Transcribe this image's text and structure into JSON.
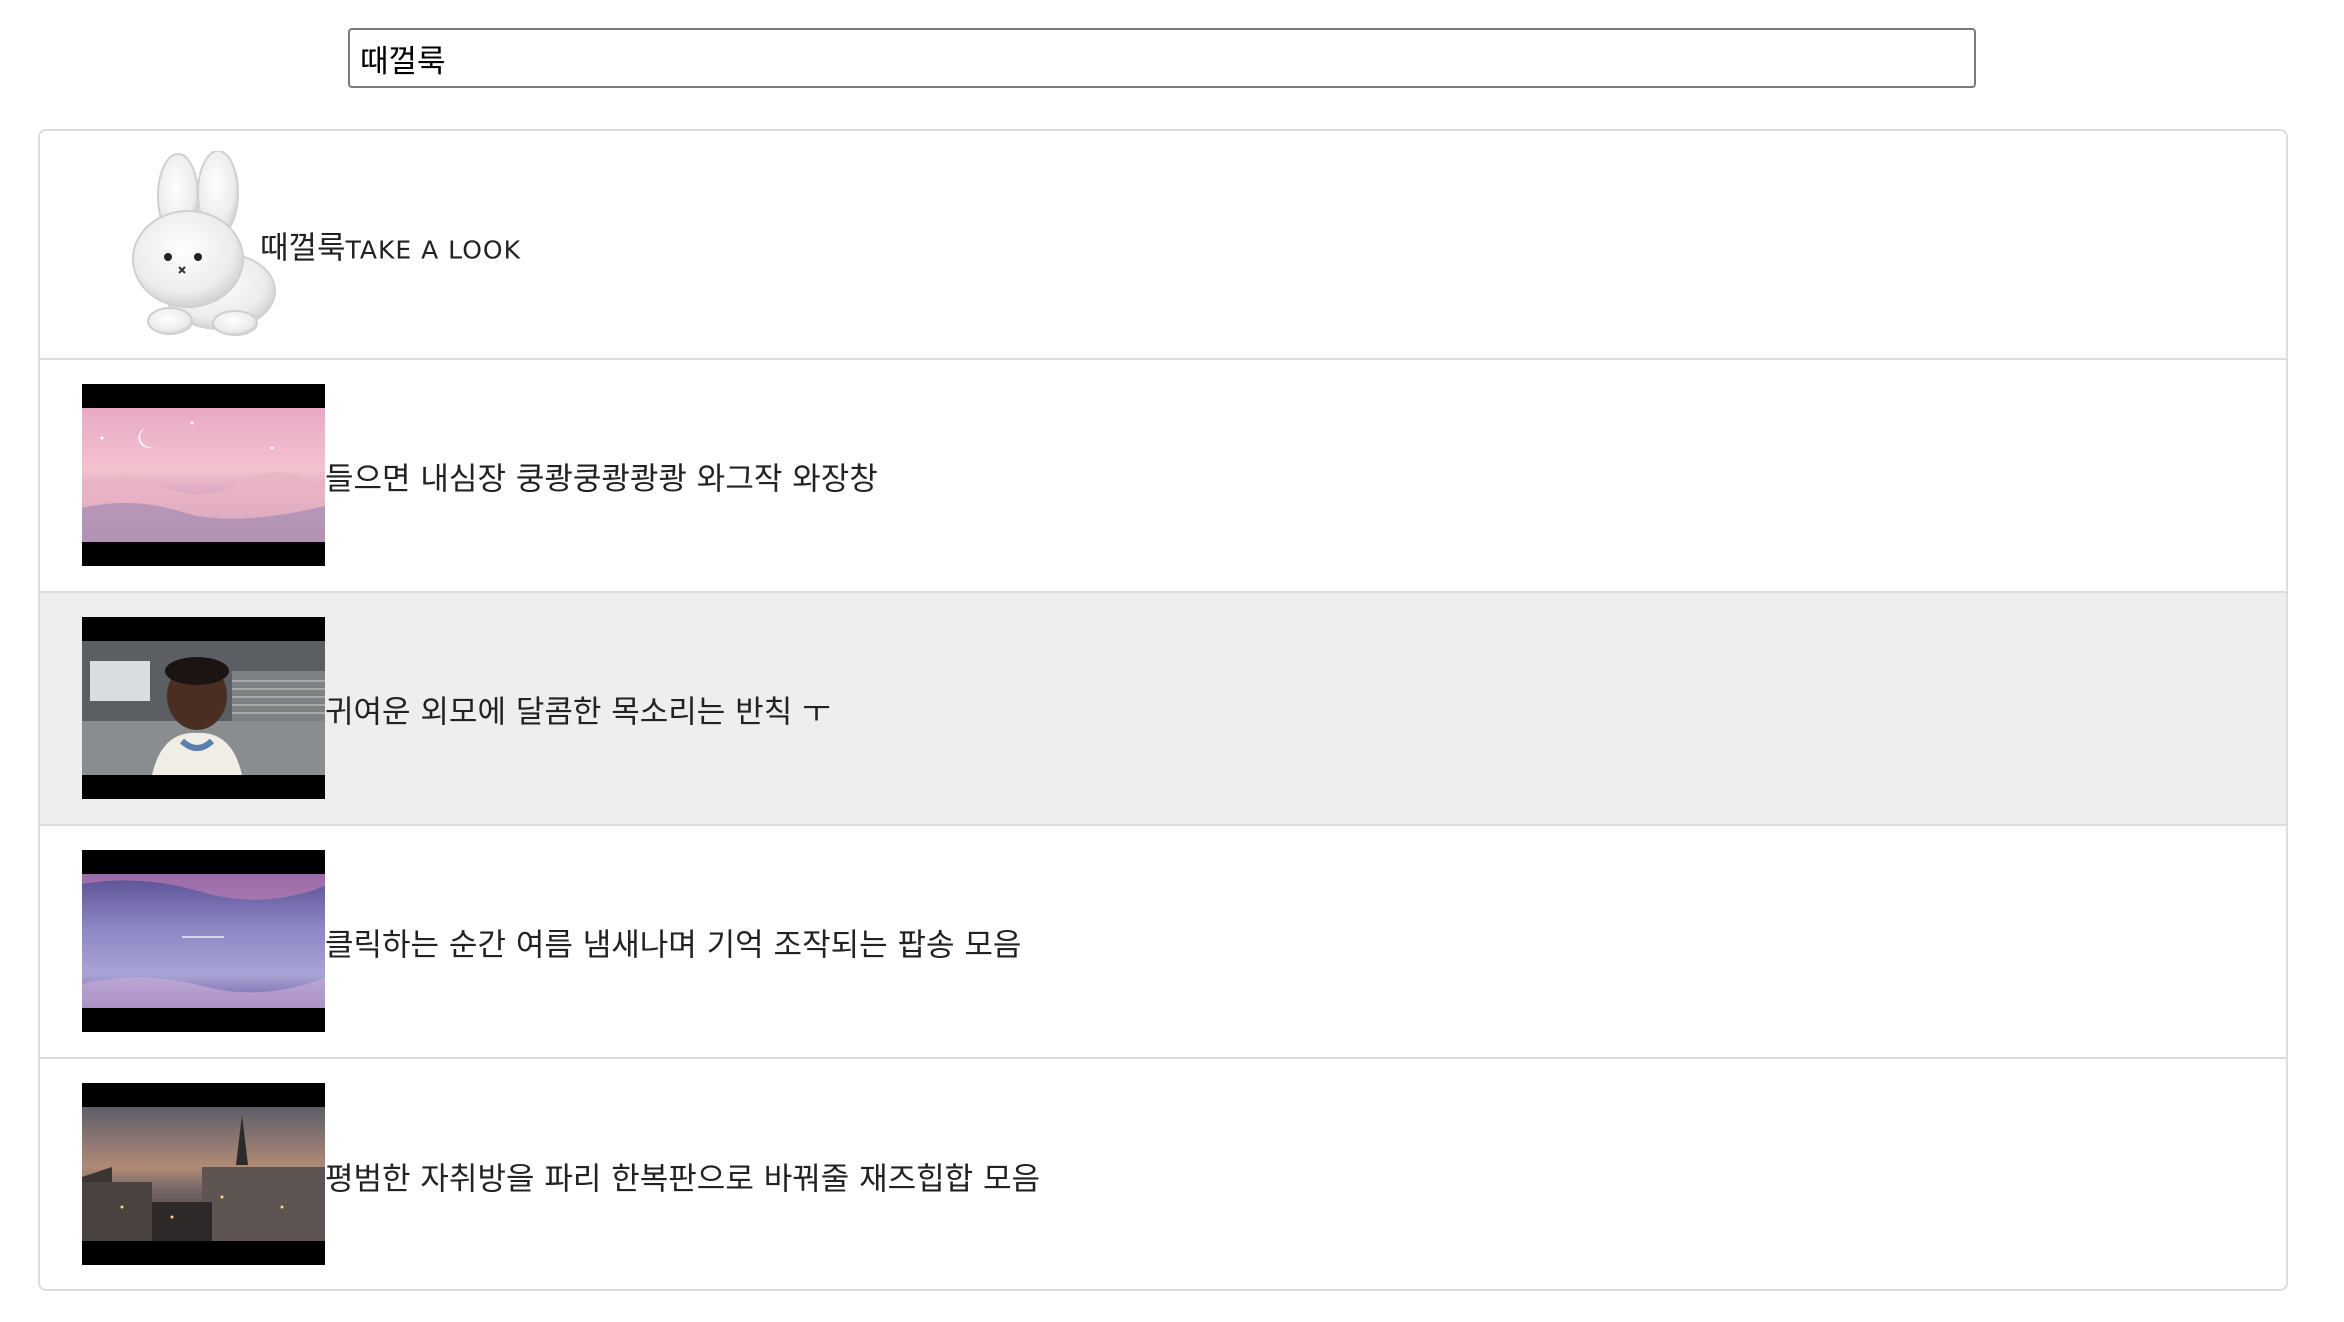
{
  "search": {
    "value": "때껄룩",
    "icon": "none"
  },
  "results": {
    "channel": {
      "name": "때껄룩",
      "tagline": "TAKE A LOOK",
      "avatar": "white-bunny-plush-avatar"
    },
    "videos": [
      {
        "title": "들으면 내심장 쿵쾅쿵쾅쾅쾅 와그작 와장창",
        "thumbnail": "pink-cloud-moon-sky"
      },
      {
        "title": "귀여운 외모에 달콤한 목소리는 반칙 ㅜ",
        "thumbnail": "singer-heart-hands-studio"
      },
      {
        "title": "클릭하는 순간 여름 냄새나며 기억 조작되는 팝송 모음",
        "thumbnail": "purple-dusk-sky"
      },
      {
        "title": "평범한 자취방을 파리 한복판으로 바꿔줄 재즈힙합 모음",
        "thumbnail": "paris-rooftops-eiffel-dusk"
      }
    ],
    "highlighted_index": 1
  }
}
